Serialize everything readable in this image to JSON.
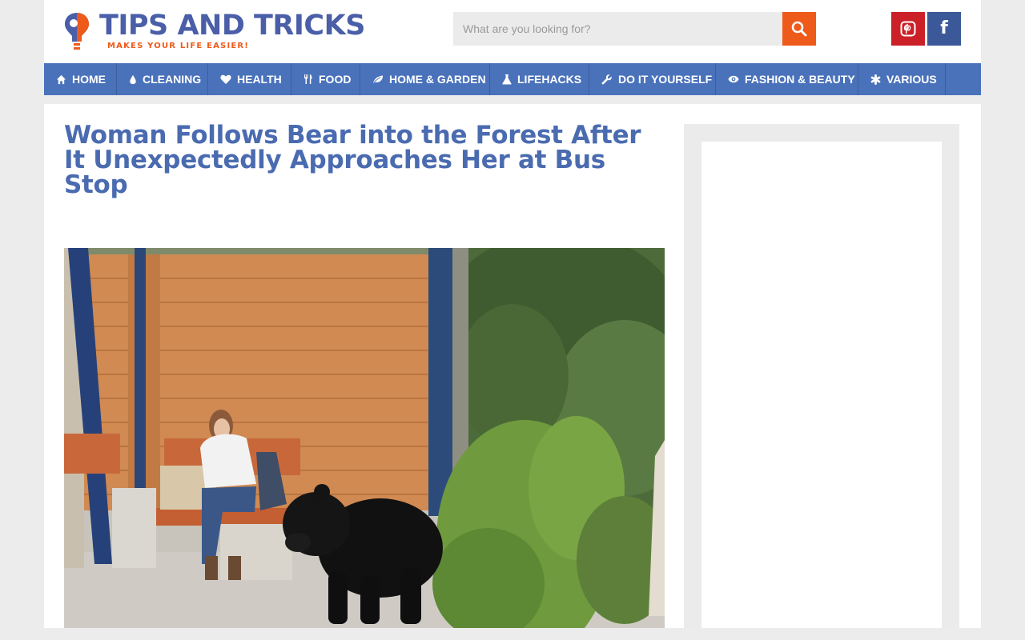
{
  "header": {
    "logo_title": "TIPS AND TRICKS",
    "logo_tagline": "MAKES YOUR LIFE EASIER!",
    "brand_blue": "#4a5fa8",
    "brand_orange": "#ee5a1a"
  },
  "search": {
    "placeholder": "What are you looking for?",
    "value": "",
    "button_icon": "search-icon"
  },
  "social": [
    {
      "name": "pinterest",
      "icon": "pinterest-icon",
      "color": "#cb2027"
    },
    {
      "name": "facebook",
      "icon": "facebook-icon",
      "color": "#3b5998",
      "glyph": "f"
    }
  ],
  "nav": {
    "color": "#4a72bb",
    "items": [
      {
        "label": "HOME",
        "icon": "home-icon"
      },
      {
        "label": "CLEANING",
        "icon": "drop-icon"
      },
      {
        "label": "HEALTH",
        "icon": "heart-icon"
      },
      {
        "label": "FOOD",
        "icon": "cutlery-icon"
      },
      {
        "label": "HOME & GARDEN",
        "icon": "leaf-icon"
      },
      {
        "label": "LIFEHACKS",
        "icon": "flask-icon"
      },
      {
        "label": "DO IT YOURSELF",
        "icon": "wrench-icon"
      },
      {
        "label": "FASHION & BEAUTY",
        "icon": "eye-icon"
      },
      {
        "label": "VARIOUS",
        "icon": "asterisk-icon"
      }
    ]
  },
  "article": {
    "title": "Woman Follows Bear into the Forest After It Unexpectedly Approaches Her at Bus Stop",
    "title_color": "#4a6bb0",
    "hero_image": "woman-at-bus-stop-with-black-bear"
  }
}
